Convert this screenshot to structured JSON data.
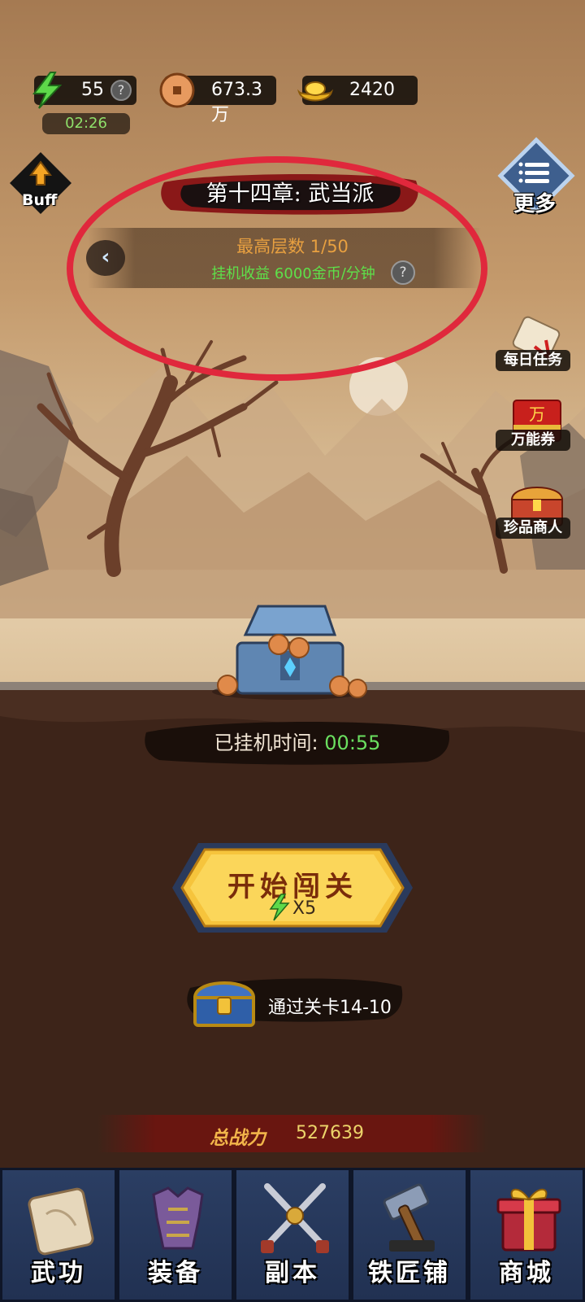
{
  "resources": {
    "energy": "55",
    "energy_help": "?",
    "energy_timer": "02:26",
    "coins": "673.3万",
    "ingots": "2420"
  },
  "buff_label": "Buff",
  "more_label": "更多",
  "chapter_title": "第十四章: 武当派",
  "floor": {
    "max_floor": "最高层数 1/50",
    "afk_income": "挂机收益 6000金币/分钟",
    "help": "?"
  },
  "side_menu": [
    {
      "label": "每日任务",
      "icon": "scroll-icon"
    },
    {
      "label": "万能券",
      "icon": "red-ticket-icon"
    },
    {
      "label": "珍品商人",
      "icon": "treasure-chest-icon"
    }
  ],
  "afk_time": {
    "label": "已挂机时间:",
    "value": "00:55"
  },
  "start_button": {
    "label": "开始闯关",
    "cost": "X5"
  },
  "stage_reward": "通过关卡14-10",
  "total_power": {
    "label": "总战力",
    "value": "527639"
  },
  "bottom_nav": [
    {
      "label": "武功",
      "icon": "martial-scroll-icon"
    },
    {
      "label": "装备",
      "icon": "armor-icon"
    },
    {
      "label": "副本",
      "icon": "crossed-swords-icon"
    },
    {
      "label": "铁匠铺",
      "icon": "hammer-icon"
    },
    {
      "label": "商城",
      "icon": "gift-box-icon"
    }
  ],
  "colors": {
    "highlight_ring": "#e0283c",
    "income_green": "#5ee04a",
    "floor_orange": "#e8a040",
    "nav_bg": "#213152"
  }
}
